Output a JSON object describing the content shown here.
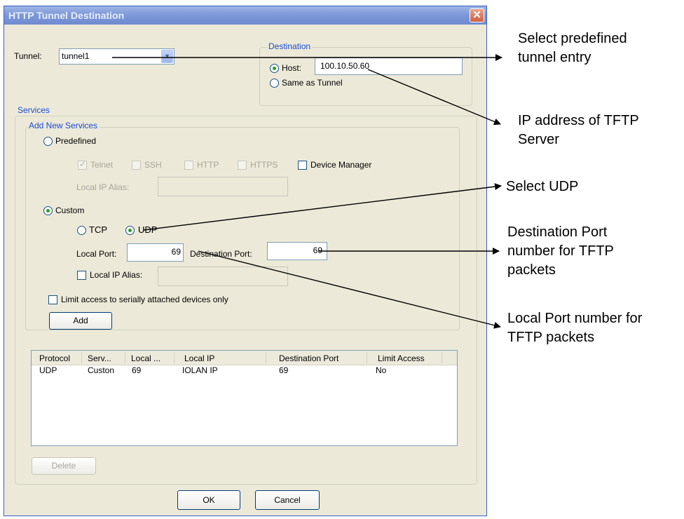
{
  "window": {
    "title": "HTTP Tunnel Destination",
    "close_symbol": "✕"
  },
  "tunnel": {
    "label": "Tunnel:",
    "value": "tunnel1"
  },
  "destination": {
    "group_label": "Destination",
    "host_label": "Host:",
    "host_value": "100.10.50.60",
    "host_selected": true,
    "same_as_tunnel_label": "Same as Tunnel"
  },
  "services": {
    "group_label": "Services",
    "add_new": {
      "group_label": "Add New Services",
      "predefined_label": "Predefined",
      "predefined_checks": {
        "telnet": {
          "label": "Telnet",
          "checked": true
        },
        "ssh": {
          "label": "SSH",
          "checked": false
        },
        "http": {
          "label": "HTTP",
          "checked": false
        },
        "https": {
          "label": "HTTPS",
          "checked": false
        }
      },
      "device_manager_label": "Device Manager",
      "predefined_local_ip_alias_label": "Local IP Alias:",
      "custom_label": "Custom",
      "custom_selected": true,
      "tcp_label": "TCP",
      "udp_label": "UDP",
      "udp_selected": true,
      "local_port_label": "Local Port:",
      "local_port_value": "69",
      "destination_port_label": "Destination Port:",
      "destination_port_value": "69",
      "local_ip_alias_label": "Local IP Alias:"
    },
    "limit_access_label": "Limit access to serially attached devices only",
    "add_button": "Add",
    "table": {
      "columns": [
        "Protocol",
        "Serv...",
        "Local ...",
        "Local IP",
        "Destination Port",
        "Limit Access"
      ],
      "rows": [
        [
          "UDP",
          "Custon",
          "69",
          "IOLAN IP",
          "69",
          "No"
        ]
      ]
    },
    "delete_button": "Delete"
  },
  "buttons": {
    "ok": "OK",
    "cancel": "Cancel"
  },
  "annotations": {
    "select_tunnel": [
      "Select predefined",
      "tunnel entry"
    ],
    "ip_address": [
      "IP address of TFTP",
      "Server"
    ],
    "select_udp": [
      "Select UDP"
    ],
    "destination_port": [
      "Destination Port",
      "number for TFTP",
      "packets"
    ],
    "local_port": [
      "Local Port number for",
      "TFTP packets"
    ]
  },
  "colors": {
    "dialog_bg": "#ece9d8",
    "title_bar": "#7e99d8",
    "group_title": "#1c4bd0",
    "close_button": "#d06040"
  }
}
